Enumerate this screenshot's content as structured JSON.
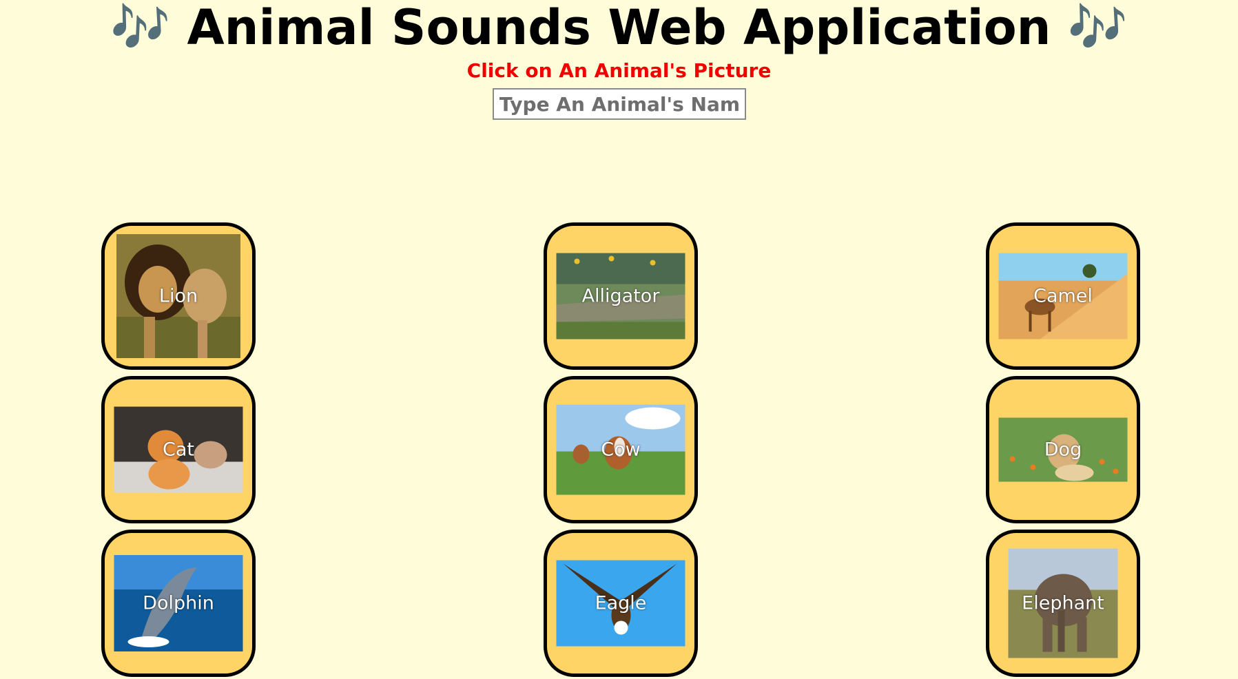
{
  "header": {
    "title": "Animal Sounds Web Application",
    "note_glyph": "🎶",
    "subtitle": "Click on An Animal's Picture"
  },
  "search": {
    "placeholder": "Type An Animal's Name",
    "value": ""
  },
  "colors": {
    "background": "#fffdd9",
    "card_fill": "#ffd466",
    "card_border": "#000000",
    "subtitle": "#f00000",
    "note_icon": "#3aa0e8"
  },
  "animals": [
    {
      "name": "Lion"
    },
    {
      "name": "Alligator"
    },
    {
      "name": "Camel"
    },
    {
      "name": "Cat"
    },
    {
      "name": "Cow"
    },
    {
      "name": "Dog"
    },
    {
      "name": "Dolphin"
    },
    {
      "name": "Eagle"
    },
    {
      "name": "Elephant"
    }
  ]
}
